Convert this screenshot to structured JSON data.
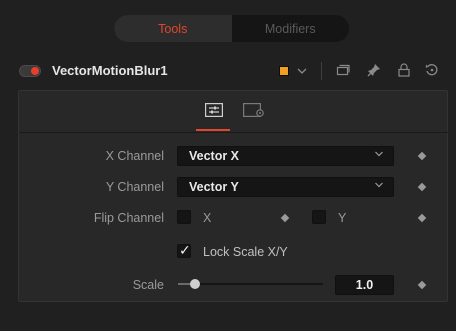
{
  "tabs": {
    "active": "Tools",
    "inactive": "Modifiers"
  },
  "header": {
    "node_name": "VectorMotionBlur1",
    "color_swatch": "#f0a020",
    "icons": [
      "color-dropdown-icon",
      "versions-icon",
      "pin-icon",
      "lock-icon",
      "reset-icon"
    ]
  },
  "subtabs": [
    "controls-icon",
    "settings-icon"
  ],
  "controls": {
    "x_channel": {
      "label": "X Channel",
      "value": "Vector X"
    },
    "y_channel": {
      "label": "Y Channel",
      "value": "Vector Y"
    },
    "flip_channel": {
      "label": "Flip Channel",
      "x_label": "X",
      "x_checked": false,
      "y_label": "Y",
      "y_checked": false
    },
    "lock_scale": {
      "label": "Lock Scale X/Y",
      "checked": true
    },
    "scale": {
      "label": "Scale",
      "value": "1.0",
      "slider_fraction": 0.12
    }
  },
  "colors": {
    "accent": "#e0462f",
    "toggle": "#e73f2b"
  }
}
